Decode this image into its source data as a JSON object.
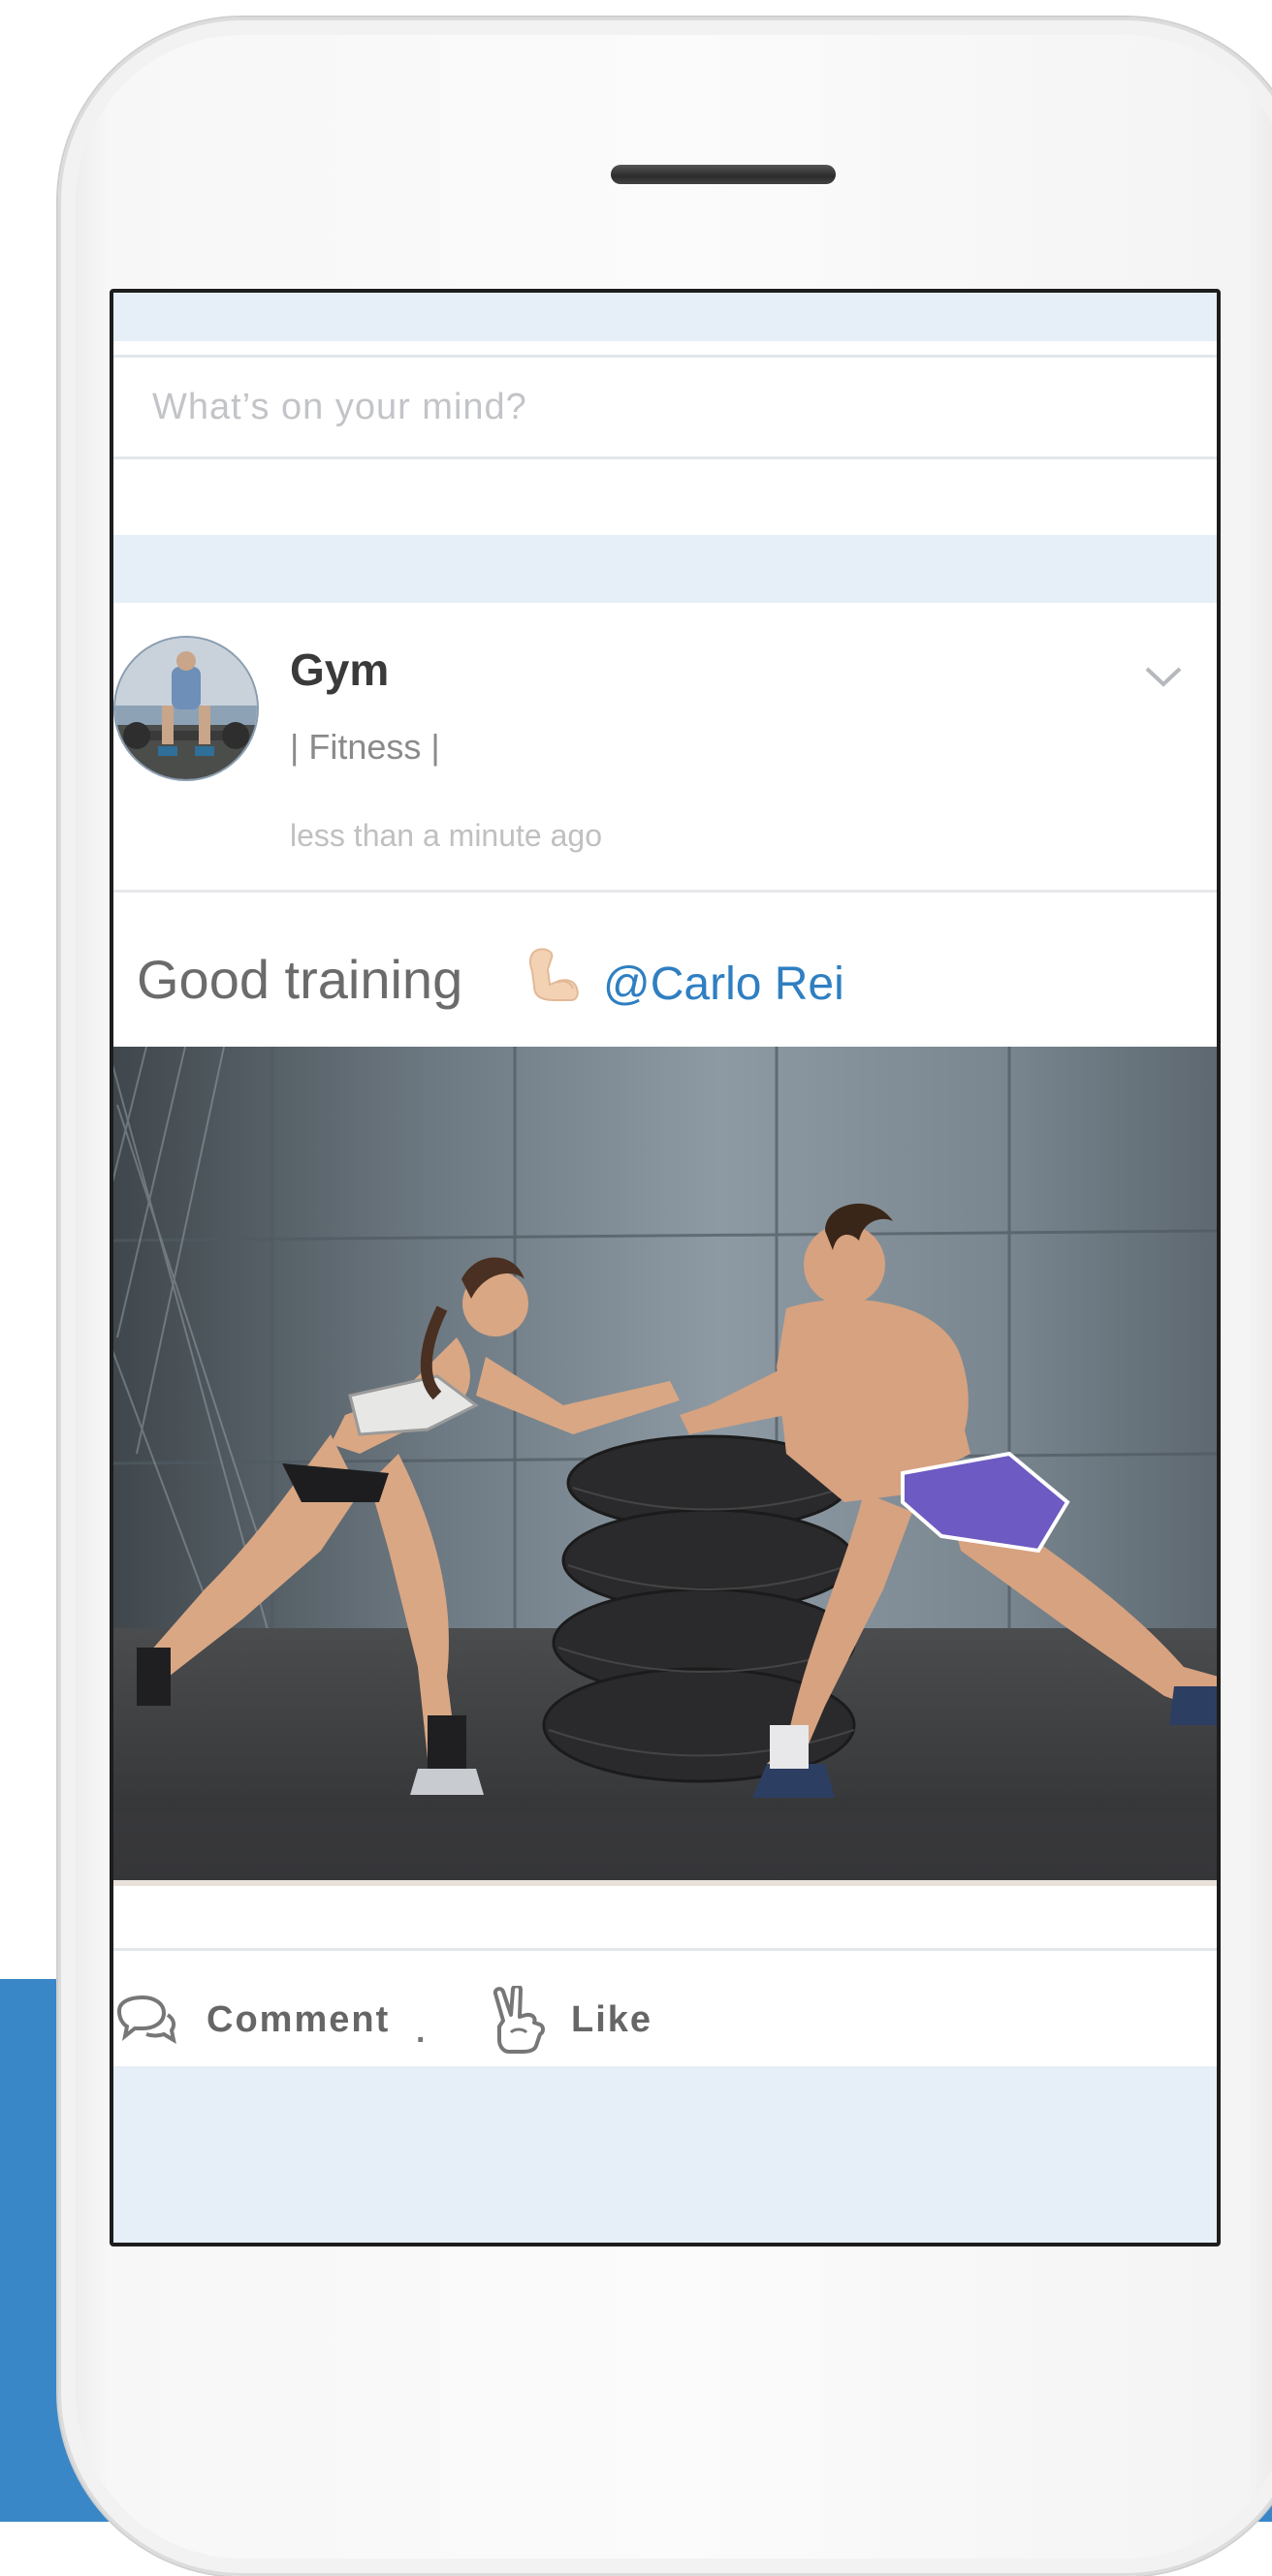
{
  "compose": {
    "placeholder": "What’s on your mind?"
  },
  "post": {
    "author": "Gym",
    "category": "| Fitness |",
    "timestamp": "less than a minute ago",
    "text": "Good training",
    "emoji": "flexed-biceps",
    "mention": "@Carlo Rei",
    "menu_icon": "chevron-down-icon"
  },
  "actions": {
    "comment_label": "Comment",
    "separator": ".",
    "like_label": "Like"
  },
  "colors": {
    "accent_blue": "#3a87c8",
    "mention_blue": "#2f7fc2",
    "feed_background": "#e6eef7"
  }
}
